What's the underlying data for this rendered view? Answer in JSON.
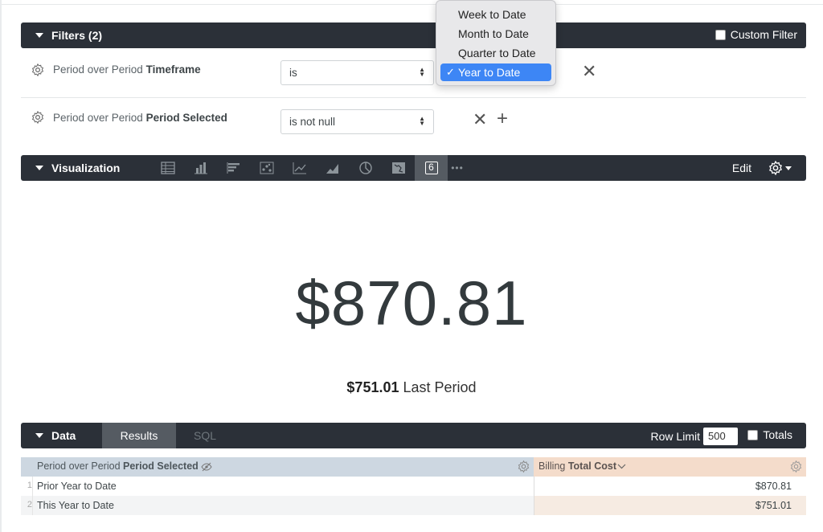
{
  "filters_bar": {
    "title": "Filters (2)",
    "custom_filter_label": "Custom Filter"
  },
  "filters": [
    {
      "label_prefix": "Period over Period ",
      "label_bold": "Timeframe",
      "operator": "is"
    },
    {
      "label_prefix": "Period over Period ",
      "label_bold": "Period Selected",
      "operator": "is not null"
    }
  ],
  "dropdown": {
    "options": [
      "Week to Date",
      "Month to Date",
      "Quarter to Date",
      "Year to Date"
    ],
    "selected": "Year to Date",
    "check": "✓"
  },
  "visualization_bar": {
    "title": "Visualization",
    "icons": [
      "table-icon",
      "column-chart-icon",
      "bar-chart-icon",
      "scatter-icon",
      "line-chart-icon",
      "area-chart-icon",
      "pie-chart-icon",
      "map-icon",
      "single-value-icon"
    ],
    "active_icon": "single-value-icon",
    "single_value_glyph": "6",
    "more": "•••",
    "edit_label": "Edit"
  },
  "single_value": {
    "value": "$870.81",
    "comparison_value": "$751.01",
    "comparison_label": "Last Period"
  },
  "data_bar": {
    "title": "Data",
    "tabs": [
      "Results",
      "SQL"
    ],
    "active_tab": "Results",
    "row_limit_label": "Row Limit",
    "row_limit_value": "500",
    "totals_label": "Totals"
  },
  "table": {
    "col1": {
      "prefix": "Period over Period ",
      "bold": "Period Selected"
    },
    "col2": {
      "prefix": "Billing ",
      "bold": "Total Cost"
    },
    "rows": [
      {
        "num": "1",
        "period": "Prior Year to Date",
        "cost": "$870.81"
      },
      {
        "num": "2",
        "period": "This Year to Date",
        "cost": "$751.01"
      }
    ]
  },
  "colors": {
    "bar_bg": "#2b3038",
    "accent_blue": "#3d86f5",
    "dim_header": "#cdd7e1",
    "measure_header": "#f4dccb"
  }
}
